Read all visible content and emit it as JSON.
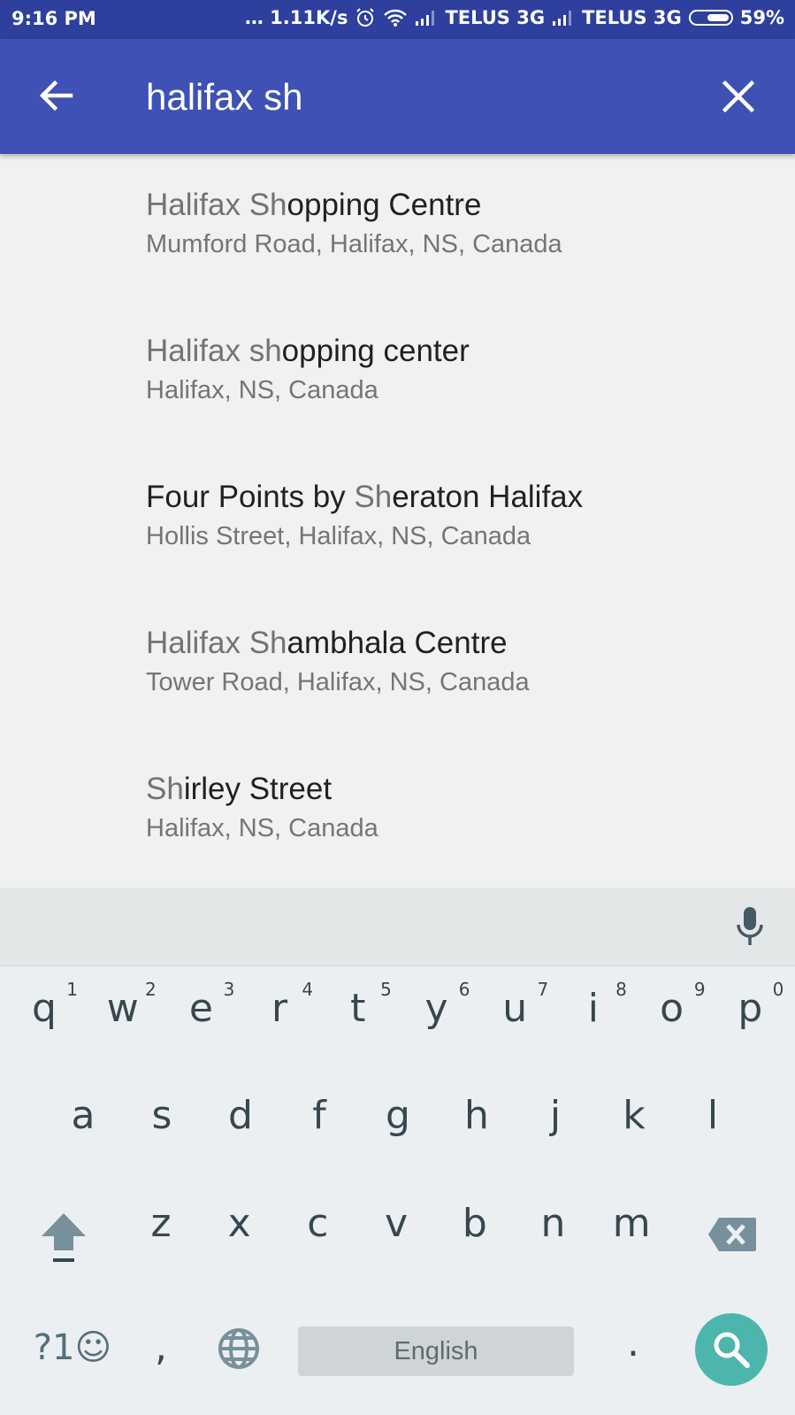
{
  "status_bar": {
    "time": "9:16 PM",
    "indicators": "… 1.11K/s",
    "carrier1": "TELUS 3G",
    "carrier2": "TELUS 3G",
    "battery": "59%",
    "battery_level": 0.59
  },
  "search": {
    "query": "halifax sh",
    "back_icon": "arrow-back-icon",
    "clear_icon": "close-icon"
  },
  "results": [
    {
      "title_pre": "",
      "title_match": "Halifax Sh",
      "title_rest": "opping Centre",
      "subtitle": "Mumford Road, Halifax, NS, Canada"
    },
    {
      "title_pre": "",
      "title_match": "Halifax sh",
      "title_rest": "opping center",
      "subtitle": "Halifax, NS, Canada"
    },
    {
      "title_pre": "Four Points by ",
      "title_match": "Sh",
      "title_rest": "eraton Halifax",
      "subtitle": "Hollis Street, Halifax, NS, Canada"
    },
    {
      "title_pre": "",
      "title_match": "Halifax Sh",
      "title_rest": "ambhala Centre",
      "subtitle": "Tower Road, Halifax, NS, Canada"
    },
    {
      "title_pre": "",
      "title_match": "Sh",
      "title_rest": "irley Street",
      "subtitle": "Halifax, NS, Canada"
    }
  ],
  "keyboard": {
    "row1": [
      {
        "key": "q",
        "hint": "1"
      },
      {
        "key": "w",
        "hint": "2"
      },
      {
        "key": "e",
        "hint": "3"
      },
      {
        "key": "r",
        "hint": "4"
      },
      {
        "key": "t",
        "hint": "5"
      },
      {
        "key": "y",
        "hint": "6"
      },
      {
        "key": "u",
        "hint": "7"
      },
      {
        "key": "i",
        "hint": "8"
      },
      {
        "key": "o",
        "hint": "9"
      },
      {
        "key": "p",
        "hint": "0"
      }
    ],
    "row2": [
      "a",
      "s",
      "d",
      "f",
      "g",
      "h",
      "j",
      "k",
      "l"
    ],
    "row3": [
      "z",
      "x",
      "c",
      "v",
      "b",
      "n",
      "m"
    ],
    "symbols_key": "?1☺",
    "comma_key": ",",
    "period_key": ".",
    "space_label": "English",
    "accent_color": "#4db6ac"
  },
  "colors": {
    "app_bar": "#3f51b5",
    "status_bar": "#2f3f9e"
  }
}
